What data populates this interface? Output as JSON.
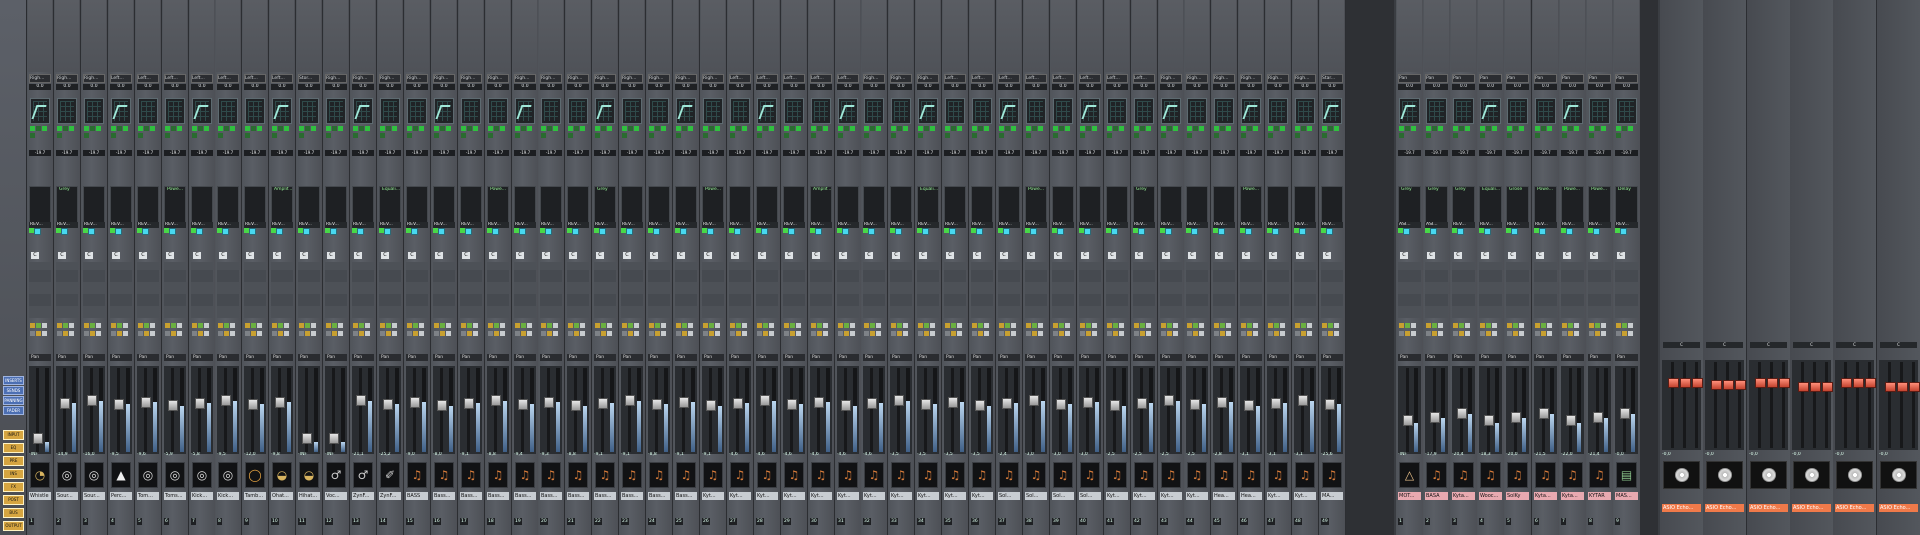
{
  "sidebar": {
    "buttons": [
      "INSERTS",
      "SENDS",
      "PANNING",
      "FADER"
    ],
    "tabs": [
      "INPUT",
      "EQ",
      "PRE",
      "INS",
      "FX",
      "POST",
      "BUS",
      "OUTPUT"
    ]
  },
  "colors": {
    "accent": "#48d8f0",
    "meter": "#7f9fc8",
    "fx_name_bg": "#f07a4a",
    "bus_name_bg": "#e8a9b0"
  },
  "tracks": [
    {
      "num": "1",
      "name": "Whistle",
      "icon": "whistle-icon",
      "db": "-INF",
      "eq": "Righ..."
    },
    {
      "num": "2",
      "name": "Sour...",
      "icon": "drum-icon",
      "db": "-14,9",
      "eq": "Righ..."
    },
    {
      "num": "3",
      "name": "Sour...",
      "icon": "drum-icon",
      "db": "-16,0",
      "eq": "Righ..."
    },
    {
      "num": "4",
      "name": "Perc...",
      "icon": "cone-icon",
      "db": "-9,5",
      "eq": "Left..."
    },
    {
      "num": "5",
      "name": "Tom...",
      "icon": "drum-icon",
      "db": "-9,6",
      "eq": "Left..."
    },
    {
      "num": "6",
      "name": "Toms...",
      "icon": "drum-icon",
      "db": "-5,9",
      "eq": "Left..."
    },
    {
      "num": "7",
      "name": "Kick...",
      "icon": "drum-icon",
      "db": "-5,8",
      "eq": "Left..."
    },
    {
      "num": "8",
      "name": "Kick...",
      "icon": "drum-icon",
      "db": "-9,5",
      "eq": "Left..."
    },
    {
      "num": "9",
      "name": "Tamb...",
      "icon": "tamb-icon",
      "db": "-12,0",
      "eq": "Left..."
    },
    {
      "num": "10",
      "name": "Ohat...",
      "icon": "cymbal-icon",
      "db": "-9,8",
      "eq": "Left..."
    },
    {
      "num": "11",
      "name": "Hihat...",
      "icon": "cymbal-icon",
      "db": "-INF",
      "eq": "Stor..."
    },
    {
      "num": "12",
      "name": "Voc...",
      "icon": "mic-icon",
      "db": "-INF",
      "eq": "Righ..."
    },
    {
      "num": "13",
      "name": "ZynF...",
      "icon": "mic-icon",
      "db": "-21,1",
      "eq": "Righ..."
    },
    {
      "num": "14",
      "name": "ZynF...",
      "icon": "sax-icon",
      "db": "-25,2",
      "eq": "Righ..."
    },
    {
      "num": "15",
      "name": "BASS",
      "icon": "guitar-icon",
      "db": "-9,0",
      "eq": "Righ..."
    },
    {
      "num": "16",
      "name": "Bass...",
      "icon": "guitar-icon",
      "db": "-8,0",
      "eq": "Righ..."
    },
    {
      "num": "17",
      "name": "Bass...",
      "icon": "guitar-icon",
      "db": "-9,1",
      "eq": "Righ..."
    },
    {
      "num": "18",
      "name": "Bass...",
      "icon": "guitar-icon",
      "db": "-8,8",
      "eq": "Righ..."
    },
    {
      "num": "19",
      "name": "Bass...",
      "icon": "guitar-icon",
      "db": "-9,4",
      "eq": "Righ..."
    },
    {
      "num": "20",
      "name": "Bass...",
      "icon": "guitar-icon",
      "db": "-9,3",
      "eq": "Righ..."
    },
    {
      "num": "21",
      "name": "Bass...",
      "icon": "guitar-icon",
      "db": "-8,8",
      "eq": "Righ..."
    },
    {
      "num": "22",
      "name": "Bass...",
      "icon": "guitar-icon",
      "db": "-9,1",
      "eq": "Righ..."
    },
    {
      "num": "23",
      "name": "Bass...",
      "icon": "guitar-icon",
      "db": "-9,1",
      "eq": "Righ..."
    },
    {
      "num": "24",
      "name": "Bass...",
      "icon": "guitar-icon",
      "db": "-8,8",
      "eq": "Righ..."
    },
    {
      "num": "25",
      "name": "Bass...",
      "icon": "guitar-icon",
      "db": "-9,1",
      "eq": "Righ..."
    },
    {
      "num": "26",
      "name": "Kyt...",
      "icon": "guitar-icon",
      "db": "-9,1",
      "eq": "Righ..."
    },
    {
      "num": "27",
      "name": "Kyt...",
      "icon": "guitar-icon",
      "db": "-4,6",
      "eq": "Left..."
    },
    {
      "num": "28",
      "name": "Kyt...",
      "icon": "guitar-icon",
      "db": "-4,6",
      "eq": "Left..."
    },
    {
      "num": "29",
      "name": "Kyt...",
      "icon": "guitar-icon",
      "db": "-4,6",
      "eq": "Left..."
    },
    {
      "num": "30",
      "name": "Kyt...",
      "icon": "guitar-icon",
      "db": "-4,6",
      "eq": "Left..."
    },
    {
      "num": "31",
      "name": "Kyt...",
      "icon": "guitar-icon",
      "db": "-4,6",
      "eq": "Left..."
    },
    {
      "num": "32",
      "name": "Kyt...",
      "icon": "guitar-icon",
      "db": "-4,6",
      "eq": "Righ..."
    },
    {
      "num": "33",
      "name": "Kyt...",
      "icon": "guitar-icon",
      "db": "-3,5",
      "eq": "Righ..."
    },
    {
      "num": "34",
      "name": "Kyt...",
      "icon": "guitar-icon",
      "db": "-3,5",
      "eq": "Righ..."
    },
    {
      "num": "35",
      "name": "Kyt...",
      "icon": "guitar-icon",
      "db": "-3,5",
      "eq": "Left..."
    },
    {
      "num": "36",
      "name": "Kyt...",
      "icon": "guitar-icon",
      "db": "-3,5",
      "eq": "Left..."
    },
    {
      "num": "37",
      "name": "Sol...",
      "icon": "guitar-icon",
      "db": "-2,4",
      "eq": "Left..."
    },
    {
      "num": "38",
      "name": "Sol...",
      "icon": "guitar-icon",
      "db": "-3,0",
      "eq": "Left..."
    },
    {
      "num": "39",
      "name": "Sol...",
      "icon": "guitar-icon",
      "db": "-3,0",
      "eq": "Left..."
    },
    {
      "num": "40",
      "name": "Sol...",
      "icon": "guitar-icon",
      "db": "-3,0",
      "eq": "Left..."
    },
    {
      "num": "41",
      "name": "Kyt...",
      "icon": "guitar-icon",
      "db": "-2,5",
      "eq": "Left..."
    },
    {
      "num": "42",
      "name": "Kyt...",
      "icon": "guitar-icon",
      "db": "-2,5",
      "eq": "Left..."
    },
    {
      "num": "43",
      "name": "Kyt...",
      "icon": "guitar-icon",
      "db": "-2,5",
      "eq": "Righ..."
    },
    {
      "num": "44",
      "name": "Kyt...",
      "icon": "guitar-icon",
      "db": "-2,5",
      "eq": "Righ..."
    },
    {
      "num": "45",
      "name": "Hea...",
      "icon": "guitar-icon",
      "db": "-2,8",
      "eq": "Righ..."
    },
    {
      "num": "46",
      "name": "Hea...",
      "icon": "guitar-icon",
      "db": "-3,1",
      "eq": "Righ..."
    },
    {
      "num": "47",
      "name": "Kyt...",
      "icon": "guitar-icon",
      "db": "-3,1",
      "eq": "Righ..."
    },
    {
      "num": "48",
      "name": "Kyt...",
      "icon": "guitar-icon",
      "db": "-3,1",
      "eq": "Righ..."
    },
    {
      "num": "49",
      "name": "MA...",
      "icon": "guitar-icon",
      "db": "-25,6",
      "eq": "Star..."
    }
  ],
  "busses": [
    {
      "num": "1",
      "name": "MOT...",
      "icon": "metronome-icon",
      "db": "-INF",
      "pan": "Pan"
    },
    {
      "num": "2",
      "name": "BASA",
      "icon": "guitar-icon",
      "db": "-17,9",
      "pan": "Pan"
    },
    {
      "num": "3",
      "name": "Kyta...",
      "icon": "guitar-icon",
      "db": "-20,4",
      "pan": "Pan"
    },
    {
      "num": "4",
      "name": "Wooc...",
      "icon": "guitar-icon",
      "db": "-18,3",
      "pan": "Pan"
    },
    {
      "num": "5",
      "name": "SolKy",
      "icon": "guitar-icon",
      "db": "-20,0",
      "pan": "Pan"
    },
    {
      "num": "6",
      "name": "Kyta...",
      "icon": "guitar-icon",
      "db": "-21,5",
      "pan": "Pan"
    },
    {
      "num": "7",
      "name": "Kyta...",
      "icon": "guitar-icon",
      "db": "-22,0",
      "pan": "Pan"
    },
    {
      "num": "8",
      "name": "KYTAR",
      "icon": "guitar-icon",
      "db": "-21,4",
      "pan": "Pan"
    },
    {
      "num": "9",
      "name": "MAS...",
      "icon": "amp-icon",
      "db": "-0,0",
      "pan": "Pan"
    }
  ],
  "fx_channels": [
    {
      "name": "ASIO Echo...",
      "db": "-0,0"
    },
    {
      "name": "ASIO Echo...",
      "db": "-0,0"
    },
    {
      "name": "ASIO Echo...",
      "db": "-0,0"
    },
    {
      "name": "ASIO Echo...",
      "db": "-0,0"
    },
    {
      "name": "ASIO Echo...",
      "db": "-0,0"
    },
    {
      "name": "ASIO Echo...",
      "db": "-0,0"
    }
  ],
  "insert_texts": [
    "Grey",
    "Grey",
    "Grey",
    "Equali...",
    "Grose",
    "Powe...",
    "Powe...",
    "Powe...",
    "Delay",
    "Amplif..."
  ],
  "send_label": "REV...",
  "send_val": "-",
  "meter_label": "-19.7",
  "trim_label": "0.0",
  "pan_label": "Pan",
  "c_label": "C",
  "asio_label": "ASI...",
  "fx_levels": [
    0.8,
    0.75,
    0.8,
    0.7,
    0.8,
    0.7
  ]
}
